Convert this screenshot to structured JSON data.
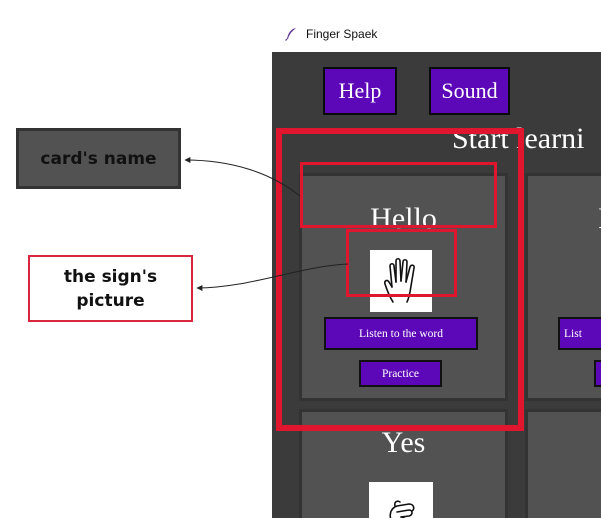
{
  "annotations": {
    "card_name": "card's name",
    "sign_picture": "the sign's\npicture"
  },
  "window": {
    "title": "Finger Spaek",
    "title_icon": "feather-icon"
  },
  "toolbar": {
    "help_label": "Help",
    "sound_label": "Sound"
  },
  "main": {
    "heading": "Start learni"
  },
  "cards": [
    {
      "name": "Hello",
      "sign_icon": "open-hand-icon",
      "listen_label": "Listen to the word",
      "practice_label": "Practice"
    },
    {
      "name": "I",
      "listen_label": "List",
      "practice_label": ""
    },
    {
      "name": "Yes",
      "sign_icon": "fist-icon"
    }
  ],
  "colors": {
    "button_purple": "#5d08b8",
    "window_bg": "#3b3b3b",
    "card_bg": "#525252",
    "highlight_red": "#e0152e"
  }
}
